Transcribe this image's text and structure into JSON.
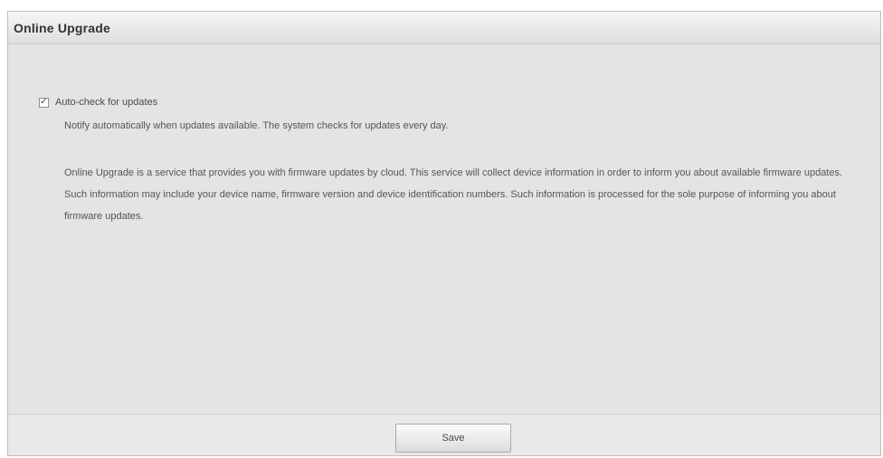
{
  "panel": {
    "title": "Online Upgrade"
  },
  "auto_check": {
    "checked": true,
    "check_glyph": "✓",
    "label": "Auto-check for updates",
    "description": "Notify automatically when updates available. The system checks for updates every day."
  },
  "info": {
    "text": "Online Upgrade is a service that provides you with firmware updates by cloud. This service will collect device information in order to inform you about available firmware updates. Such information may include your device name, firmware version and device identification numbers. Such information is processed for the sole purpose of informing you about firmware updates."
  },
  "footer": {
    "save_label": "Save"
  }
}
